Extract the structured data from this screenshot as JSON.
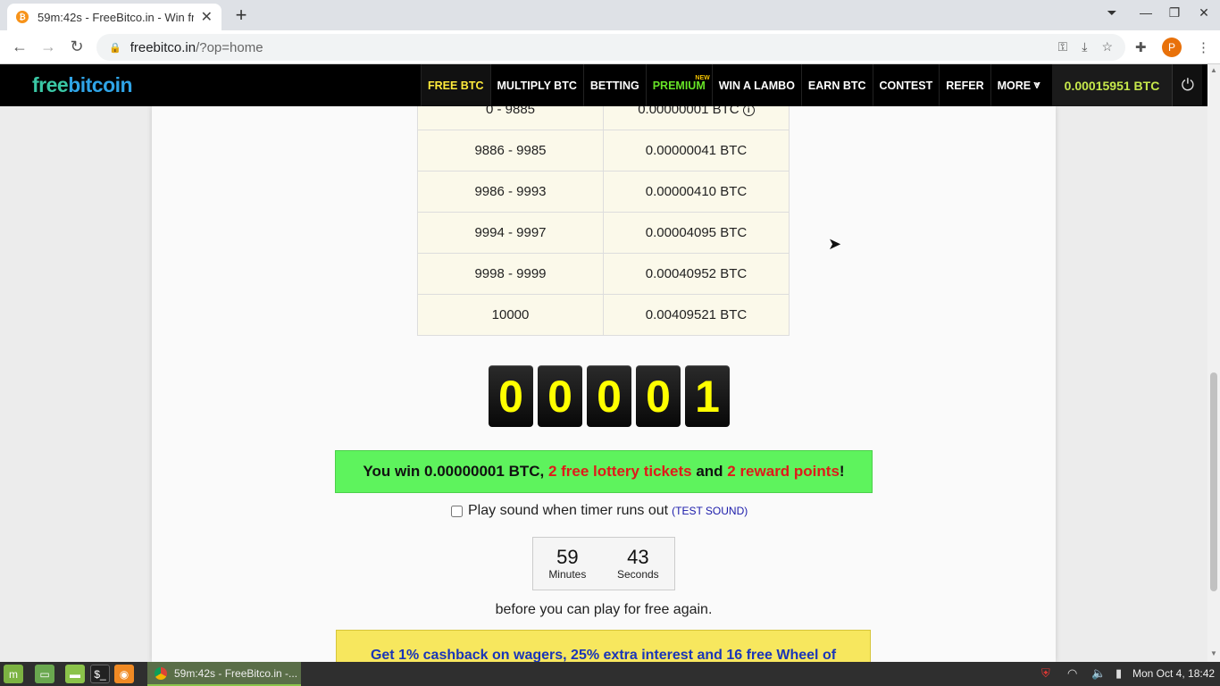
{
  "browser": {
    "tab_title": "59m:42s - FreeBitco.in - Win fre",
    "tab_favicon": "₿",
    "url_host": "freebitco.in",
    "url_path": "/?op=home",
    "profile_initial": "P"
  },
  "site": {
    "logo_part1": "free",
    "logo_part2": "bitcoin",
    "nav": {
      "free_btc": "FREE BTC",
      "multiply_btc": "MULTIPLY BTC",
      "betting": "BETTING",
      "premium": "PREMIUM",
      "premium_badge": "NEW",
      "win_a_lambo": "WIN A LAMBO",
      "earn_btc": "EARN BTC",
      "contest": "CONTEST",
      "refer": "REFER",
      "more": "MORE"
    },
    "balance": "0.00015951 BTC"
  },
  "payout_table": [
    {
      "range": "0 - 9885",
      "payout": "0.00000001 BTC"
    },
    {
      "range": "9886 - 9985",
      "payout": "0.00000041 BTC"
    },
    {
      "range": "9986 - 9993",
      "payout": "0.00000410 BTC"
    },
    {
      "range": "9994 - 9997",
      "payout": "0.00004095 BTC"
    },
    {
      "range": "9998 - 9999",
      "payout": "0.00040952 BTC"
    },
    {
      "range": "10000",
      "payout": "0.00409521 BTC"
    }
  ],
  "roll_digits": [
    "0",
    "0",
    "0",
    "0",
    "1"
  ],
  "win_message": {
    "prefix": "You win 0.00000001 BTC, ",
    "tickets": "2 free lottery tickets",
    "middle": " and ",
    "points": "2 reward points",
    "suffix": "!"
  },
  "sound": {
    "label": "Play sound when timer runs out",
    "test_link": "(TEST SOUND)",
    "checked": false
  },
  "timer": {
    "minutes": "59",
    "minutes_label": "Minutes",
    "seconds": "43",
    "seconds_label": "Seconds"
  },
  "before_text": "before you can play for free again.",
  "cashback_text": "Get 1% cashback on wagers, 25% extra interest and 16 free Wheel of",
  "taskbar": {
    "task_label": "59m:42s - FreeBitco.in -...",
    "clock": "Mon Oct  4, 18:42"
  },
  "colors": {
    "win_green": "#5ef35d",
    "digit_yellow": "#ffff00",
    "balance_green": "#c6e84b",
    "cashback_yellow": "#f7e75e"
  }
}
